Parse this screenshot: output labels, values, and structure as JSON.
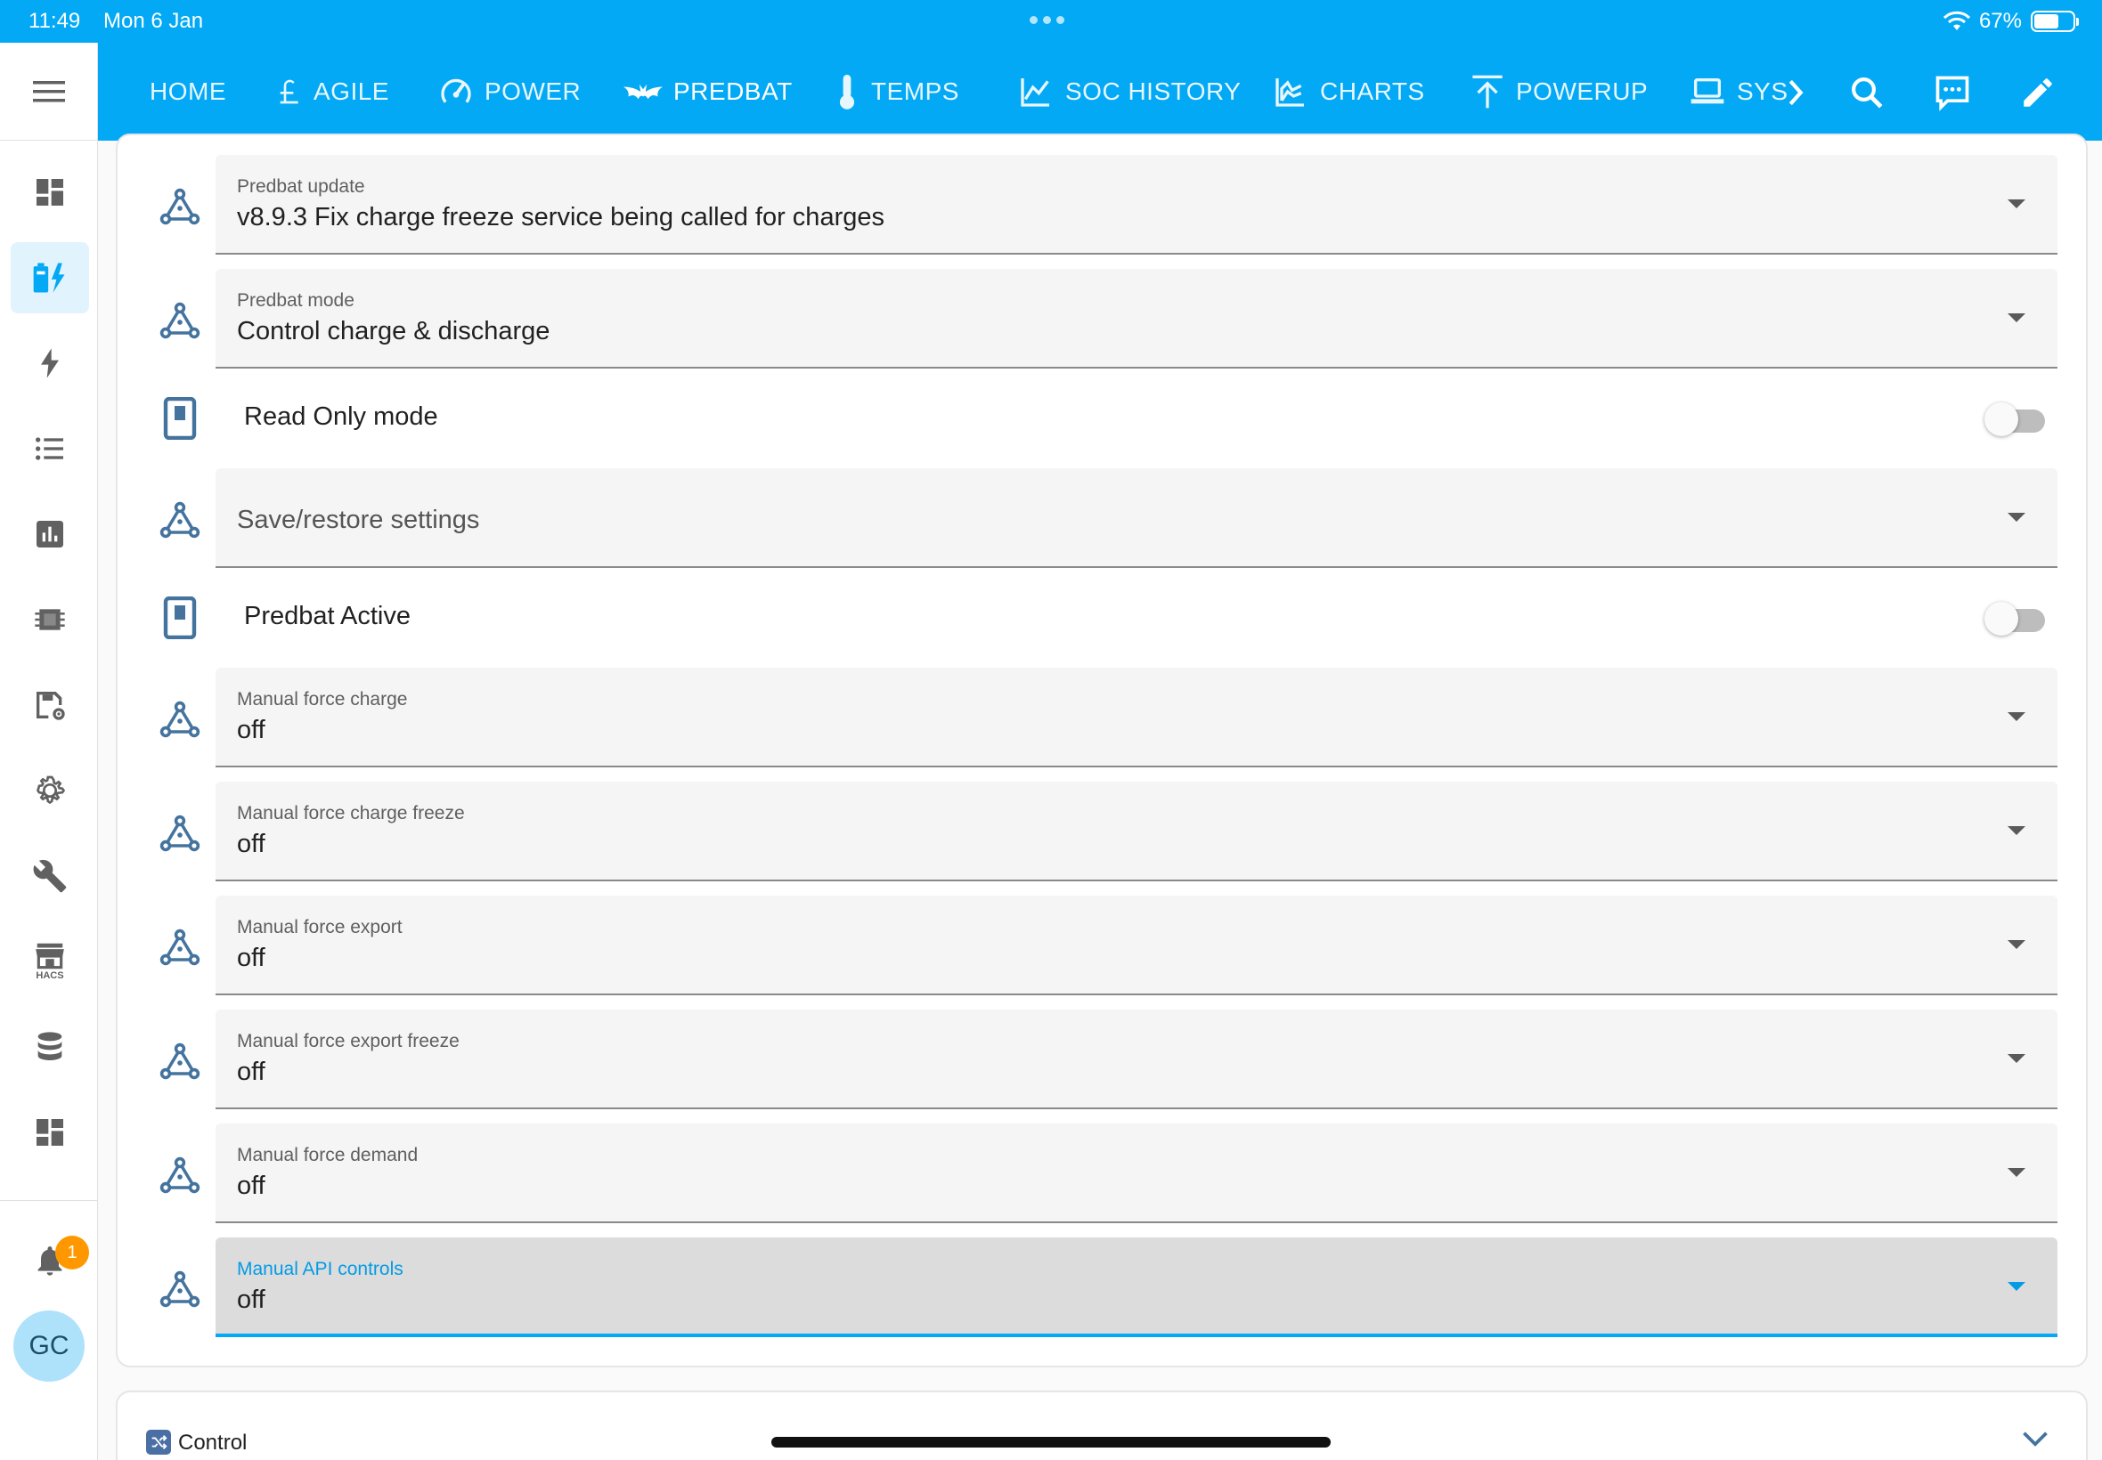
{
  "status": {
    "time": "11:49",
    "date": "Mon 6 Jan",
    "battery": "67%",
    "battery_level": 0.67
  },
  "nav": {
    "tabs": [
      {
        "label": "HOME",
        "icon": "none"
      },
      {
        "label": "AGILE",
        "icon": "pound-icon"
      },
      {
        "label": "POWER",
        "icon": "gauge-icon"
      },
      {
        "label": "PREDBAT",
        "icon": "bat-icon"
      },
      {
        "label": "TEMPS",
        "icon": "thermometer-icon"
      },
      {
        "label": "SOC HISTORY",
        "icon": "line-chart-icon"
      },
      {
        "label": "CHARTS",
        "icon": "area-chart-icon"
      },
      {
        "label": "POWERUP",
        "icon": "upload-arrow-icon"
      },
      {
        "label": "SYS",
        "icon": "laptop-icon"
      }
    ],
    "active_tab": "PREDBAT",
    "actions": [
      "search-icon",
      "chat-icon",
      "pencil-icon"
    ]
  },
  "sidebar": {
    "items": [
      "dashboard-icon",
      "battery-charge-icon",
      "lightning-icon",
      "list-icon",
      "bar-chart-icon",
      "chip-icon",
      "save-settings-icon",
      "gear-icon",
      "wrench-icon",
      "hacs-store-icon",
      "database-icon",
      "dashboard-icon"
    ],
    "active_index": 1,
    "hacs_label": "HACS",
    "notifications_count": "1",
    "avatar_initials": "GC"
  },
  "rows": [
    {
      "type": "select",
      "label": "Predbat update",
      "value": "v8.9.3 Fix charge freeze service being called for charges"
    },
    {
      "type": "select",
      "label": "Predbat mode",
      "value": "Control charge & discharge"
    },
    {
      "type": "toggle",
      "label": "Read Only mode",
      "state": "off"
    },
    {
      "type": "select",
      "label": "",
      "value": "Save/restore settings"
    },
    {
      "type": "toggle",
      "label": "Predbat Active",
      "state": "off"
    },
    {
      "type": "select",
      "label": "Manual force charge",
      "value": "off"
    },
    {
      "type": "select",
      "label": "Manual force charge freeze",
      "value": "off"
    },
    {
      "type": "select",
      "label": "Manual force export",
      "value": "off"
    },
    {
      "type": "select",
      "label": "Manual force export freeze",
      "value": "off"
    },
    {
      "type": "select",
      "label": "Manual force demand",
      "value": "off"
    },
    {
      "type": "select",
      "label": "Manual API controls",
      "value": "off",
      "focused": true
    }
  ],
  "control_card": {
    "label": "Control"
  },
  "colors": {
    "accent": "#03a9f4",
    "focus": "#039be5",
    "icon_blue": "#44739e",
    "badge": "#ff9800"
  }
}
